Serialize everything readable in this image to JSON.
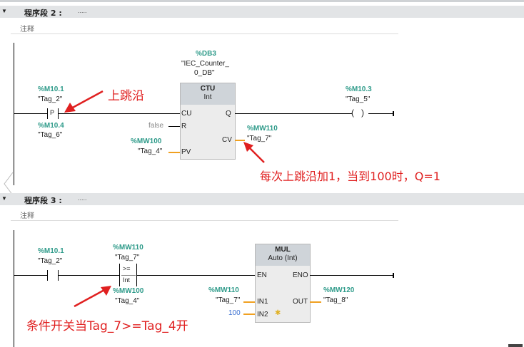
{
  "network2": {
    "title": "程序段 2 :",
    "dots": ".....",
    "comment": "注释",
    "contact": {
      "address": "%M10.1",
      "tag": "\"Tag_2\"",
      "symbol": "P",
      "edge_address": "%M10.4",
      "edge_tag": "\"Tag_6\""
    },
    "instance": {
      "db": "%DB3",
      "name_line1": "\"IEC_Counter_",
      "name_line2": "0_DB\""
    },
    "block": {
      "title": "CTU",
      "type": "Int",
      "pin_cu": "CU",
      "pin_r": "R",
      "pin_pv": "PV",
      "pin_q": "Q",
      "pin_cv": "CV"
    },
    "r_value": "false",
    "pv": {
      "address": "%MW100",
      "tag": "\"Tag_4\""
    },
    "cv": {
      "address": "%MW110",
      "tag": "\"Tag_7\""
    },
    "coil": {
      "address": "%M10.3",
      "tag": "\"Tag_5\""
    },
    "annotation_edge": "上跳沿",
    "annotation_count": "每次上跳沿加1，当到100时，Q=1"
  },
  "network3": {
    "title": "程序段 3 :",
    "dots": ".....",
    "comment": "注释",
    "contact": {
      "address": "%M10.1",
      "tag": "\"Tag_2\""
    },
    "compare": {
      "address_top": "%MW110",
      "tag_top": "\"Tag_7\"",
      "op": ">=",
      "type": "Int",
      "address_bottom": "%MW100",
      "tag_bottom": "\"Tag_4\""
    },
    "block": {
      "title": "MUL",
      "type": "Auto (Int)",
      "pin_en": "EN",
      "pin_eno": "ENO",
      "pin_in1": "IN1",
      "pin_in2": "IN2",
      "pin_out": "OUT"
    },
    "in1": {
      "address": "%MW110",
      "tag": "\"Tag_7\""
    },
    "in2_value": "100",
    "out": {
      "address": "%MW120",
      "tag": "\"Tag_8\""
    },
    "annotation": "条件开关当Tag_7>=Tag_4开"
  },
  "colors": {
    "address": "#2f9b8a",
    "annotation": "#e02020",
    "wire": "#000000",
    "param_wire": "#f0a020",
    "header_bg": "#e2e4e6"
  }
}
